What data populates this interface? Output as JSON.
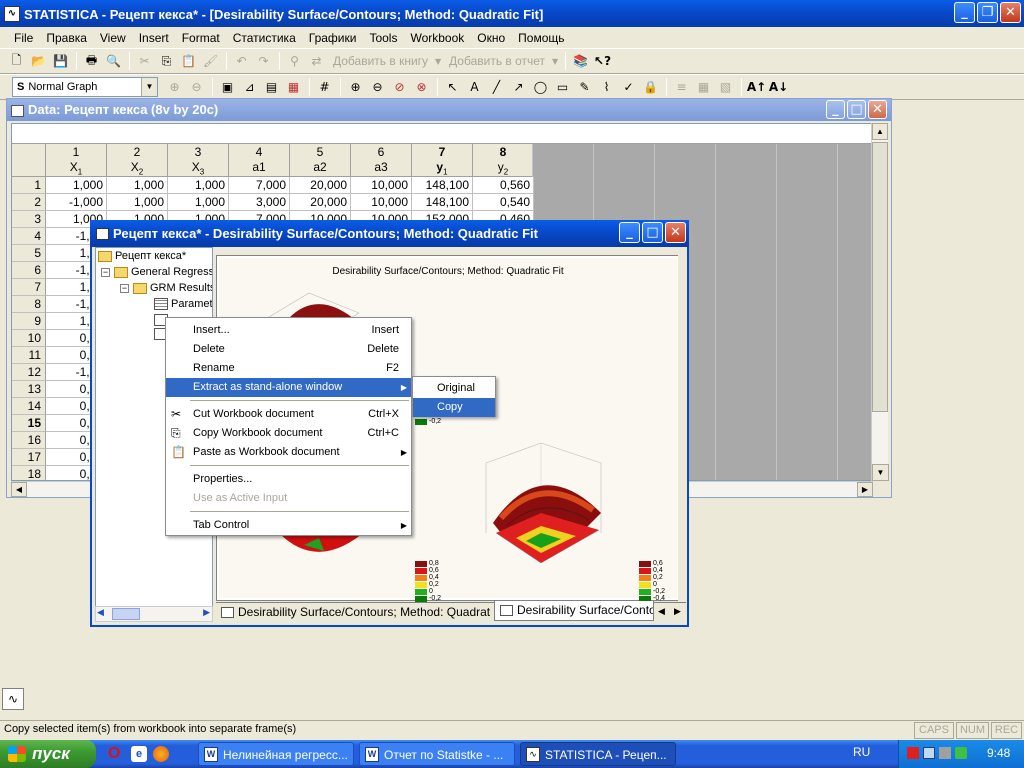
{
  "app": {
    "title": "STATISTICA - Рецепт кекса* - [Desirability Surface/Contours; Method: Quadratic Fit]"
  },
  "menu": [
    "File",
    "Правка",
    "View",
    "Insert",
    "Format",
    "Статистика",
    "Графики",
    "Tools",
    "Workbook",
    "Окно",
    "Помощь"
  ],
  "toolbar1": {
    "add_workbook": "Добавить в книгу",
    "add_report": "Добавить в отчет"
  },
  "toolbar2": {
    "graph_select": "Normal Graph"
  },
  "datawin": {
    "title": "Data: Рецепт кекса (8v by 20c)",
    "columns": [
      {
        "num": "1",
        "name": "X",
        "sub": "1"
      },
      {
        "num": "2",
        "name": "X",
        "sub": "2"
      },
      {
        "num": "3",
        "name": "X",
        "sub": "3"
      },
      {
        "num": "4",
        "name": "a1",
        "sub": ""
      },
      {
        "num": "5",
        "name": "a2",
        "sub": ""
      },
      {
        "num": "6",
        "name": "a3",
        "sub": ""
      },
      {
        "num": "7",
        "name": "y",
        "sub": "1"
      },
      {
        "num": "8",
        "name": "y",
        "sub": "2"
      }
    ],
    "rows": [
      {
        "n": "1",
        "v": [
          "1,000",
          "1,000",
          "1,000",
          "7,000",
          "20,000",
          "10,000",
          "148,100",
          "0,560"
        ]
      },
      {
        "n": "2",
        "v": [
          "-1,000",
          "1,000",
          "1,000",
          "3,000",
          "20,000",
          "10,000",
          "148,100",
          "0,540"
        ]
      },
      {
        "n": "3",
        "v": [
          "1,000",
          "1,000",
          "1,000",
          "7,000",
          "10,000",
          "10,000",
          "152,000",
          "0,460"
        ]
      },
      {
        "n": "4",
        "v": [
          "-1,00"
        ]
      },
      {
        "n": "5",
        "v": [
          "1,00"
        ]
      },
      {
        "n": "6",
        "v": [
          "-1,00"
        ]
      },
      {
        "n": "7",
        "v": [
          "1,00"
        ]
      },
      {
        "n": "8",
        "v": [
          "-1,00"
        ]
      },
      {
        "n": "9",
        "v": [
          "1,68"
        ]
      },
      {
        "n": "10",
        "v": [
          "0,00"
        ]
      },
      {
        "n": "11",
        "v": [
          "0,00"
        ]
      },
      {
        "n": "12",
        "v": [
          "-1,68"
        ]
      },
      {
        "n": "13",
        "v": [
          "0,00"
        ]
      },
      {
        "n": "14",
        "v": [
          "0,00"
        ]
      },
      {
        "n": "15",
        "v": [
          "0,00"
        ]
      },
      {
        "n": "16",
        "v": [
          "0,00"
        ]
      },
      {
        "n": "17",
        "v": [
          "0,00"
        ]
      },
      {
        "n": "18",
        "v": [
          "0,00"
        ]
      }
    ]
  },
  "workbook": {
    "title": "Рецепт кекса* - Desirability Surface/Contours; Method: Quadratic Fit",
    "tree": {
      "root": "Рецепт кекса*",
      "level1": "General Regress",
      "level2": "GRM Results",
      "level3": "Paramet"
    },
    "graph_title": "Desirability Surface/Contours; Method: Quadratic Fit",
    "legend1": [
      "0,8",
      "0,6",
      "0,4",
      "0,2",
      "0",
      "-0,2"
    ],
    "legend2": [
      "0,6",
      "0,4",
      "0,2",
      "0",
      "-0,2",
      "-0,4"
    ],
    "legend_partial": "-0,2",
    "tab1": "Desirability Surface/Contours; Method: Quadratic Fit",
    "tab2": "Desirability Surface/Contour"
  },
  "context_menu": {
    "items": [
      {
        "label": "Insert...",
        "shortcut": "Insert"
      },
      {
        "label": "Delete",
        "shortcut": "Delete"
      },
      {
        "label": "Rename",
        "shortcut": "F2"
      },
      {
        "label": "Extract as stand-alone window",
        "shortcut": ""
      },
      {
        "label": "Cut Workbook document",
        "shortcut": "Ctrl+X"
      },
      {
        "label": "Copy Workbook document",
        "shortcut": "Ctrl+C"
      },
      {
        "label": "Paste as Workbook document",
        "shortcut": ""
      },
      {
        "label": "Properties...",
        "shortcut": ""
      },
      {
        "label": "Use as Active Input",
        "shortcut": ""
      },
      {
        "label": "Tab Control",
        "shortcut": ""
      }
    ]
  },
  "submenu": {
    "original": "Original",
    "copy": "Copy"
  },
  "status": {
    "text": "Copy selected item(s) from workbook into separate frame(s)",
    "caps": "CAPS",
    "num": "NUM",
    "rec": "REC"
  },
  "taskbar": {
    "start": "пуск",
    "tasks": [
      "Нелинейная регресс...",
      "Отчет по Statistke - ...",
      "STATISTICA - Рецеп..."
    ],
    "lang": "RU",
    "clock": "9:48"
  },
  "colors": {
    "accent": "#316ac5",
    "titlebar": "#0848c8",
    "taskbar": "#245edb",
    "start": "#3c9b32"
  }
}
